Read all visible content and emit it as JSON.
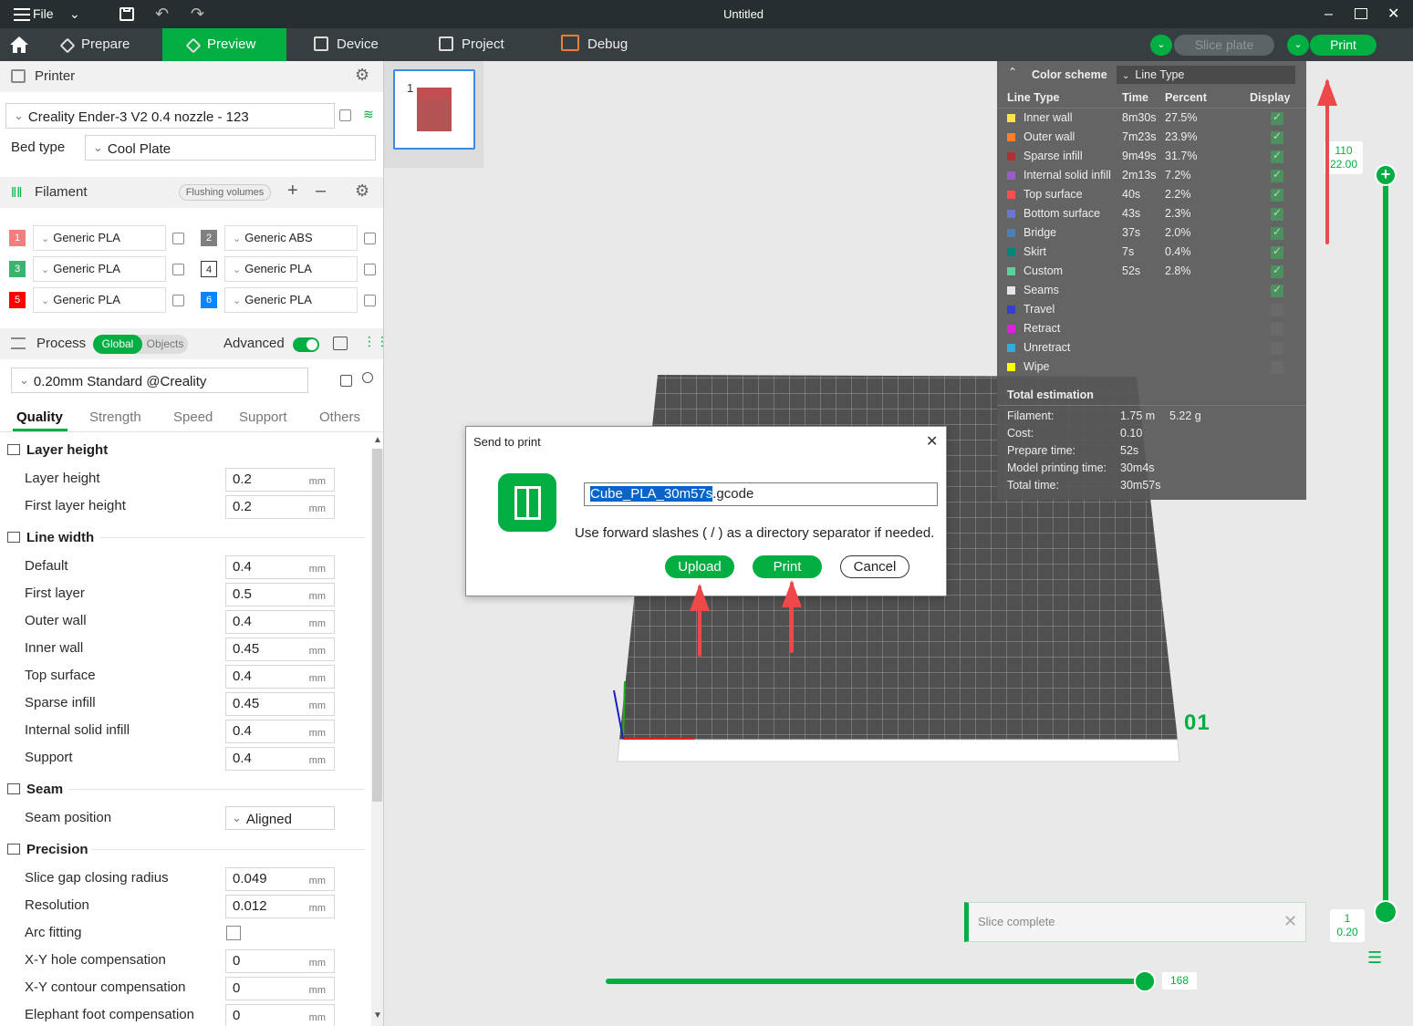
{
  "window": {
    "title": "Untitled",
    "file_label": "File"
  },
  "nav": {
    "tabs": [
      {
        "label": "Prepare"
      },
      {
        "label": "Preview"
      },
      {
        "label": "Device"
      },
      {
        "label": "Project"
      },
      {
        "label": "Debug"
      }
    ],
    "slice_plate_label": "Slice plate",
    "print_label": "Print"
  },
  "printer": {
    "section_label": "Printer",
    "name": "Creality Ender-3 V2 0.4 nozzle - 123",
    "bed_type_label": "Bed type",
    "bed_type_value": "Cool Plate"
  },
  "filament": {
    "section_label": "Filament",
    "flushing_label": "Flushing volumes",
    "slots": [
      {
        "num": "1",
        "name": "Generic PLA",
        "color": "#f08080"
      },
      {
        "num": "2",
        "name": "Generic ABS",
        "color": "#808080"
      },
      {
        "num": "3",
        "name": "Generic PLA",
        "color": "#3cb371"
      },
      {
        "num": "4",
        "name": "Generic PLA",
        "color": "#ffffff"
      },
      {
        "num": "5",
        "name": "Generic PLA",
        "color": "#ff0000"
      },
      {
        "num": "6",
        "name": "Generic PLA",
        "color": "#0a84ff"
      }
    ]
  },
  "process": {
    "section_label": "Process",
    "global_label": "Global",
    "objects_label": "Objects",
    "advanced_label": "Advanced",
    "advanced_on": true,
    "preset": "0.20mm Standard @Creality",
    "tabs": [
      "Quality",
      "Strength",
      "Speed",
      "Support",
      "Others"
    ],
    "active_tab": "Quality",
    "groups": {
      "layer_height": {
        "title": "Layer height",
        "rows": [
          {
            "label": "Layer height",
            "value": "0.2",
            "unit": "mm"
          },
          {
            "label": "First layer height",
            "value": "0.2",
            "unit": "mm"
          }
        ]
      },
      "line_width": {
        "title": "Line width",
        "rows": [
          {
            "label": "Default",
            "value": "0.4",
            "unit": "mm"
          },
          {
            "label": "First layer",
            "value": "0.5",
            "unit": "mm"
          },
          {
            "label": "Outer wall",
            "value": "0.4",
            "unit": "mm"
          },
          {
            "label": "Inner wall",
            "value": "0.45",
            "unit": "mm"
          },
          {
            "label": "Top surface",
            "value": "0.4",
            "unit": "mm"
          },
          {
            "label": "Sparse infill",
            "value": "0.45",
            "unit": "mm"
          },
          {
            "label": "Internal solid infill",
            "value": "0.4",
            "unit": "mm"
          },
          {
            "label": "Support",
            "value": "0.4",
            "unit": "mm"
          }
        ]
      },
      "seam": {
        "title": "Seam",
        "rows": [
          {
            "label": "Seam position",
            "value": "Aligned"
          }
        ]
      },
      "precision": {
        "title": "Precision",
        "rows": [
          {
            "label": "Slice gap closing radius",
            "value": "0.049",
            "unit": "mm"
          },
          {
            "label": "Resolution",
            "value": "0.012",
            "unit": "mm"
          },
          {
            "label": "Arc fitting",
            "checked": false
          },
          {
            "label": "X-Y hole compensation",
            "value": "0",
            "unit": "mm"
          },
          {
            "label": "X-Y contour compensation",
            "value": "0",
            "unit": "mm"
          },
          {
            "label": "Elephant foot compensation",
            "value": "0",
            "unit": "mm"
          }
        ]
      }
    }
  },
  "plate": {
    "thumb_number": "1",
    "plate_label": "01"
  },
  "legend": {
    "color_scheme_label": "Color scheme",
    "color_scheme_value": "Line Type",
    "headers": {
      "type": "Line Type",
      "time": "Time",
      "percent": "Percent",
      "display": "Display"
    },
    "rows": [
      {
        "name": "Inner wall",
        "time": "8m30s",
        "percent": "27.5%",
        "color": "#ffe14d",
        "display": true
      },
      {
        "name": "Outer wall",
        "time": "7m23s",
        "percent": "23.9%",
        "color": "#ff7f27",
        "display": true
      },
      {
        "name": "Sparse infill",
        "time": "9m49s",
        "percent": "31.7%",
        "color": "#b03030",
        "display": true
      },
      {
        "name": "Internal solid infill",
        "time": "2m13s",
        "percent": "7.2%",
        "color": "#9a5cc6",
        "display": true
      },
      {
        "name": "Top surface",
        "time": "40s",
        "percent": "2.2%",
        "color": "#ff4d4d",
        "display": true
      },
      {
        "name": "Bottom surface",
        "time": "43s",
        "percent": "2.3%",
        "color": "#6679cc",
        "display": true
      },
      {
        "name": "Bridge",
        "time": "37s",
        "percent": "2.0%",
        "color": "#4d80b3",
        "display": true
      },
      {
        "name": "Skirt",
        "time": "7s",
        "percent": "0.4%",
        "color": "#00877a",
        "display": true
      },
      {
        "name": "Custom",
        "time": "52s",
        "percent": "2.8%",
        "color": "#5ed19a",
        "display": true
      },
      {
        "name": "Seams",
        "time": "",
        "percent": "",
        "color": "#e6e6e6",
        "display": true
      },
      {
        "name": "Travel",
        "time": "",
        "percent": "",
        "color": "#3340cc",
        "display": false
      },
      {
        "name": "Retract",
        "time": "",
        "percent": "",
        "color": "#e020e0",
        "display": false
      },
      {
        "name": "Unretract",
        "time": "",
        "percent": "",
        "color": "#33aadd",
        "display": false
      },
      {
        "name": "Wipe",
        "time": "",
        "percent": "",
        "color": "#ffff00",
        "display": false
      }
    ],
    "total": {
      "title": "Total estimation",
      "filament_label": "Filament:",
      "filament_len": "1.75 m",
      "filament_weight": "5.22 g",
      "cost_label": "Cost:",
      "cost": "0.10",
      "prepare_label": "Prepare time:",
      "prepare": "52s",
      "model_label": "Model printing time:",
      "model": "30m4s",
      "total_label": "Total time:",
      "total": "30m57s"
    }
  },
  "dialog": {
    "title": "Send to print",
    "filename_selected": "Cube_PLA_30m57s",
    "filename_ext": ".gcode",
    "hint": "Use forward slashes ( / ) as a directory separator if needed.",
    "upload_label": "Upload",
    "print_label": "Print",
    "cancel_label": "Cancel"
  },
  "layer_slider": {
    "top_layer": "110",
    "top_height": "22.00",
    "bottom_layer": "1",
    "bottom_height": "0.20"
  },
  "move_slider": {
    "value": "168"
  },
  "notification": {
    "text": "Slice complete"
  },
  "colors": {
    "accent": "#00ae42",
    "titlebar": "#262e30",
    "navbar": "#363e41",
    "annotation_arrow": "#ef4848"
  }
}
